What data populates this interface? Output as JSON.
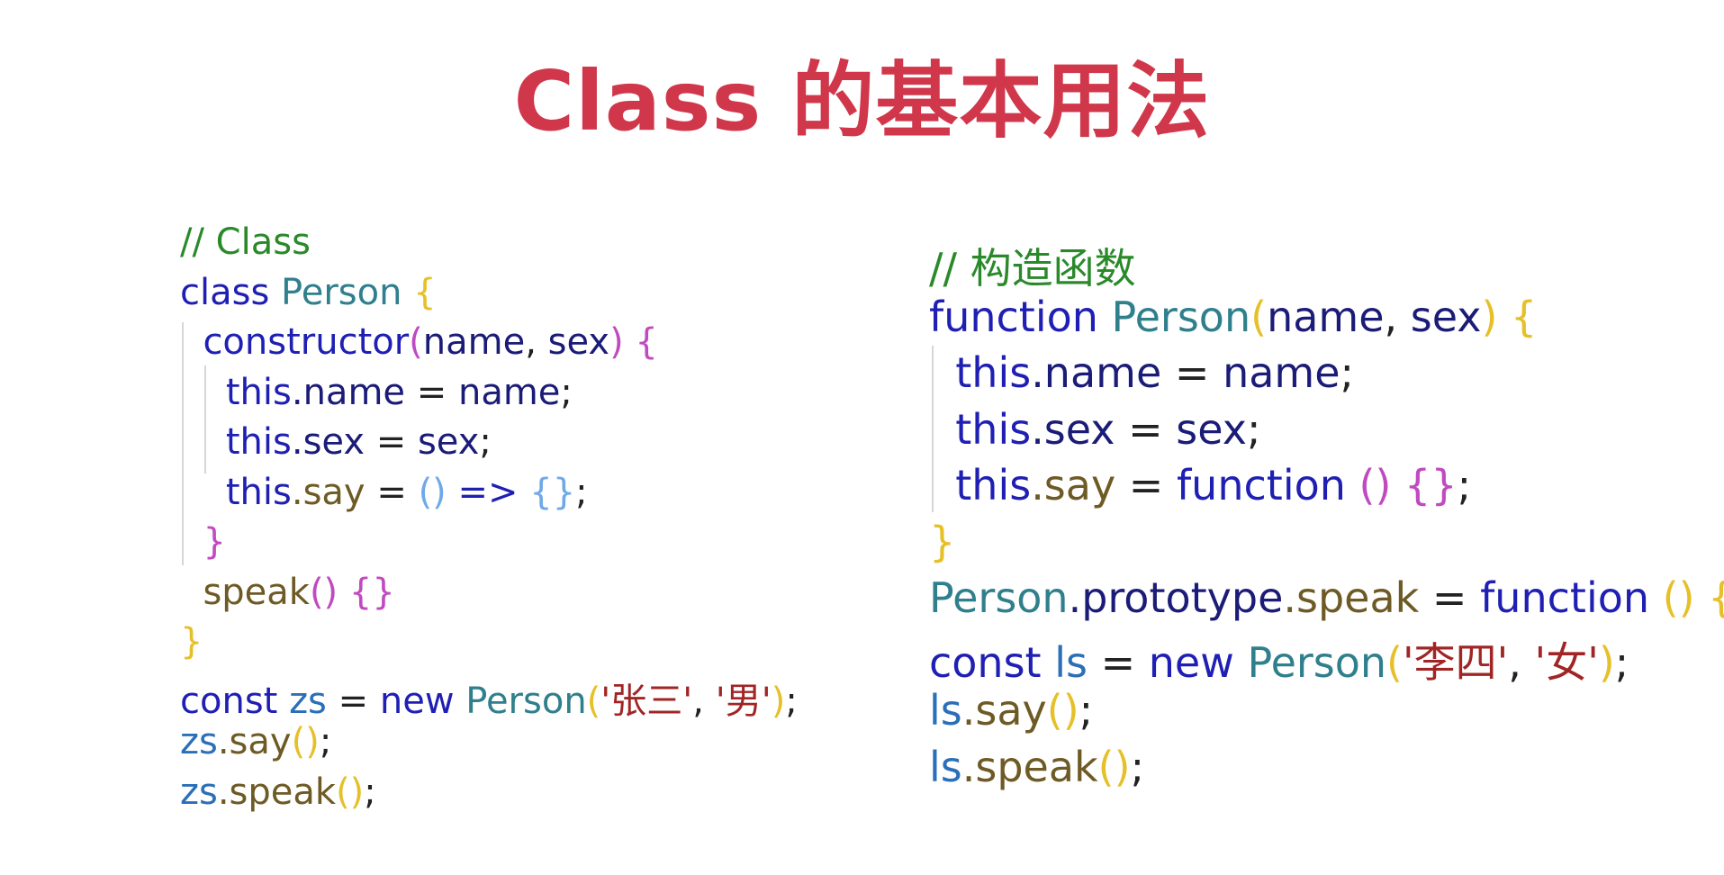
{
  "title": "Class 的基本用法",
  "left_code": {
    "comment": "// Class",
    "lines": [
      [
        {
          "t": "// Class",
          "c": "comment"
        }
      ],
      [
        {
          "t": "class ",
          "c": "keyword"
        },
        {
          "t": "Person ",
          "c": "class"
        },
        {
          "t": "{",
          "c": "brace1"
        }
      ],
      [
        {
          "t": "  "
        },
        {
          "t": "constructor",
          "c": "keyword"
        },
        {
          "t": "(",
          "c": "brace2"
        },
        {
          "t": "name",
          "c": "param"
        },
        {
          "t": ", ",
          "c": "punct"
        },
        {
          "t": "sex",
          "c": "param"
        },
        {
          "t": ") ",
          "c": "brace2"
        },
        {
          "t": "{",
          "c": "brace2"
        }
      ],
      [
        {
          "t": "    "
        },
        {
          "t": "this",
          "c": "keyword"
        },
        {
          "t": ".name",
          "c": "prop"
        },
        {
          "t": " = ",
          "c": "punct"
        },
        {
          "t": "name",
          "c": "param"
        },
        {
          "t": ";",
          "c": "punct"
        }
      ],
      [
        {
          "t": "    "
        },
        {
          "t": "this",
          "c": "keyword"
        },
        {
          "t": ".sex",
          "c": "prop"
        },
        {
          "t": " = ",
          "c": "punct"
        },
        {
          "t": "sex",
          "c": "param"
        },
        {
          "t": ";",
          "c": "punct"
        }
      ],
      [
        {
          "t": "    "
        },
        {
          "t": "this",
          "c": "keyword"
        },
        {
          "t": ".say",
          "c": "method"
        },
        {
          "t": " = ",
          "c": "punct"
        },
        {
          "t": "()",
          "c": "brace3"
        },
        {
          "t": " => ",
          "c": "keyword"
        },
        {
          "t": "{}",
          "c": "brace3"
        },
        {
          "t": ";",
          "c": "punct"
        }
      ],
      [
        {
          "t": "  "
        },
        {
          "t": "}",
          "c": "brace2"
        }
      ],
      [
        {
          "t": "  "
        },
        {
          "t": "speak",
          "c": "method"
        },
        {
          "t": "()",
          "c": "brace2"
        },
        {
          "t": " "
        },
        {
          "t": "{}",
          "c": "brace2"
        }
      ],
      [
        {
          "t": "}",
          "c": "brace1"
        }
      ],
      [
        {
          "t": "const ",
          "c": "keyword"
        },
        {
          "t": "zs",
          "c": "var"
        },
        {
          "t": " = ",
          "c": "punct"
        },
        {
          "t": "new ",
          "c": "keyword"
        },
        {
          "t": "Person",
          "c": "class"
        },
        {
          "t": "(",
          "c": "brace1"
        },
        {
          "t": "'张三'",
          "c": "string"
        },
        {
          "t": ", ",
          "c": "punct"
        },
        {
          "t": "'男'",
          "c": "string"
        },
        {
          "t": ")",
          "c": "brace1"
        },
        {
          "t": ";",
          "c": "punct"
        }
      ],
      [
        {
          "t": "zs",
          "c": "var"
        },
        {
          "t": ".say",
          "c": "method"
        },
        {
          "t": "()",
          "c": "brace1"
        },
        {
          "t": ";",
          "c": "punct"
        }
      ],
      [
        {
          "t": "zs",
          "c": "var"
        },
        {
          "t": ".speak",
          "c": "method"
        },
        {
          "t": "()",
          "c": "brace1"
        },
        {
          "t": ";",
          "c": "punct"
        }
      ]
    ]
  },
  "right_code": {
    "comment": "// 构造函数",
    "lines": [
      [
        {
          "t": "// 构造函数",
          "c": "comment"
        }
      ],
      [
        {
          "t": "function ",
          "c": "keyword"
        },
        {
          "t": "Person",
          "c": "class"
        },
        {
          "t": "(",
          "c": "brace1"
        },
        {
          "t": "name",
          "c": "param"
        },
        {
          "t": ", ",
          "c": "punct"
        },
        {
          "t": "sex",
          "c": "param"
        },
        {
          "t": ") ",
          "c": "brace1"
        },
        {
          "t": "{",
          "c": "brace1"
        }
      ],
      [
        {
          "t": "  "
        },
        {
          "t": "this",
          "c": "keyword"
        },
        {
          "t": ".name",
          "c": "prop"
        },
        {
          "t": " = ",
          "c": "punct"
        },
        {
          "t": "name",
          "c": "param"
        },
        {
          "t": ";",
          "c": "punct"
        }
      ],
      [
        {
          "t": "  "
        },
        {
          "t": "this",
          "c": "keyword"
        },
        {
          "t": ".sex",
          "c": "prop"
        },
        {
          "t": " = ",
          "c": "punct"
        },
        {
          "t": "sex",
          "c": "param"
        },
        {
          "t": ";",
          "c": "punct"
        }
      ],
      [
        {
          "t": "  "
        },
        {
          "t": "this",
          "c": "keyword"
        },
        {
          "t": ".say",
          "c": "method"
        },
        {
          "t": " = ",
          "c": "punct"
        },
        {
          "t": "function ",
          "c": "keyword"
        },
        {
          "t": "()",
          "c": "brace2"
        },
        {
          "t": " "
        },
        {
          "t": "{}",
          "c": "brace2"
        },
        {
          "t": ";",
          "c": "punct"
        }
      ],
      [
        {
          "t": "}",
          "c": "brace1"
        }
      ],
      [
        {
          "t": "Person",
          "c": "class"
        },
        {
          "t": ".prototype",
          "c": "prop"
        },
        {
          "t": ".speak",
          "c": "method"
        },
        {
          "t": " = ",
          "c": "punct"
        },
        {
          "t": "function ",
          "c": "keyword"
        },
        {
          "t": "()",
          "c": "brace1"
        },
        {
          "t": " "
        },
        {
          "t": "{}",
          "c": "brace1"
        },
        {
          "t": ";",
          "c": "punct"
        }
      ],
      [
        {
          "t": "const ",
          "c": "keyword"
        },
        {
          "t": "ls",
          "c": "var"
        },
        {
          "t": " = ",
          "c": "punct"
        },
        {
          "t": "new ",
          "c": "keyword"
        },
        {
          "t": "Person",
          "c": "class"
        },
        {
          "t": "(",
          "c": "brace1"
        },
        {
          "t": "'李四'",
          "c": "string"
        },
        {
          "t": ", ",
          "c": "punct"
        },
        {
          "t": "'女'",
          "c": "string"
        },
        {
          "t": ")",
          "c": "brace1"
        },
        {
          "t": ";",
          "c": "punct"
        }
      ],
      [
        {
          "t": "ls",
          "c": "var"
        },
        {
          "t": ".say",
          "c": "method"
        },
        {
          "t": "()",
          "c": "brace1"
        },
        {
          "t": ";",
          "c": "punct"
        }
      ],
      [
        {
          "t": "ls",
          "c": "var"
        },
        {
          "t": ".speak",
          "c": "method"
        },
        {
          "t": "()",
          "c": "brace1"
        },
        {
          "t": ";",
          "c": "punct"
        }
      ]
    ]
  },
  "colors": {
    "title": "#d0374b",
    "comment": "#2a8a2a",
    "keyword": "#1f1fb4",
    "class": "#2f7f8c",
    "string": "#a12525",
    "method": "#6e5a24"
  }
}
